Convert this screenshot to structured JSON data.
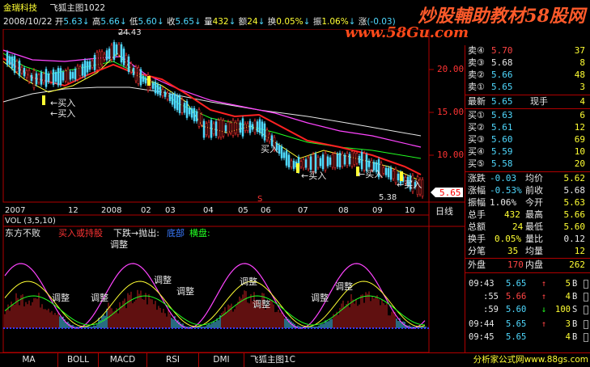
{
  "header": {
    "stock_name": "金瑞科技",
    "chart_name": "飞狐主图1022",
    "date": "2008/10/22",
    "open_label": "开",
    "open": "5.63",
    "high_label": "高",
    "high": "5.66",
    "low_label": "低",
    "low": "5.60",
    "close_label": "收",
    "close": "5.65",
    "volume_label": "量",
    "volume": "432",
    "amount_label": "额",
    "amount": "24",
    "turnover_label": "换",
    "turnover": "0.05%",
    "amplitude_label": "振",
    "amplitude": "1.06%",
    "change_label": "涨",
    "change": "(-0.03)",
    "arrow": "↓"
  },
  "watermark": {
    "line1": "炒股輔助教材58股网",
    "line2": "www.58Gu.com"
  },
  "main_chart": {
    "price_axis": [
      "20.00",
      "15.00",
      "10.00"
    ],
    "current_price_tag": "5.65",
    "peak_label": "24.43",
    "low_label": "5.38",
    "buy_labels": [
      "←买入",
      "←买入",
      "买入",
      "←买入",
      "←买入",
      "←买入"
    ],
    "marker_s": "S",
    "x_labels": [
      "2007",
      "12",
      "2008",
      "02",
      "03",
      "04",
      "05",
      "06",
      "07",
      "08",
      "09",
      "10"
    ],
    "period_label": "日线"
  },
  "volume_panel": {
    "label": "VOL (3,5,10)"
  },
  "indicator": {
    "name": "东方不败",
    "legend_buy_hold": "买入或持股",
    "legend_down_sell": "下跌→抛出:",
    "legend_bottom": "底部",
    "legend_flat": "横盘:",
    "adjust_label": "调整",
    "adjust_labels": [
      "调整",
      "调整",
      "调整",
      "调整",
      "调整",
      "调整",
      "调整",
      "调整",
      "调整"
    ]
  },
  "quote_panel": {
    "ask": [
      {
        "label": "卖④",
        "price": "5.70",
        "vol": "37"
      },
      {
        "label": "卖③",
        "price": "5.68",
        "vol": "8"
      },
      {
        "label": "卖②",
        "price": "5.66",
        "vol": "48"
      },
      {
        "label": "卖①",
        "price": "5.65",
        "vol": "3"
      }
    ],
    "latest_label": "最新",
    "latest": "5.65",
    "hand_label": "现手",
    "hand": "4",
    "bid": [
      {
        "label": "买①",
        "price": "5.63",
        "vol": "6"
      },
      {
        "label": "买②",
        "price": "5.61",
        "vol": "12"
      },
      {
        "label": "买③",
        "price": "5.60",
        "vol": "69"
      },
      {
        "label": "买④",
        "price": "5.59",
        "vol": "10"
      },
      {
        "label": "买⑤",
        "price": "5.58",
        "vol": "20"
      }
    ],
    "stats": [
      {
        "l1": "涨跌",
        "v1": "-0.03",
        "l2": "均价",
        "v2": "5.62"
      },
      {
        "l1": "涨幅",
        "v1": "-0.53%",
        "l2": "前收",
        "v2": "5.68"
      },
      {
        "l1": "振幅",
        "v1": "1.06%",
        "l2": "今开",
        "v2": "5.63"
      },
      {
        "l1": "总手",
        "v1": "432",
        "l2": "最高",
        "v2": "5.66"
      },
      {
        "l1": "总额",
        "v1": "24",
        "l2": "最低",
        "v2": "5.60"
      },
      {
        "l1": "换手",
        "v1": "0.05%",
        "l2": "量比",
        "v2": "0.12"
      },
      {
        "l1": "分笔",
        "v1": "35",
        "l2": "均量",
        "v2": "12"
      }
    ],
    "outer_label": "外盘",
    "outer": "170",
    "inner_label": "内盘",
    "inner": "262",
    "ticks": [
      {
        "time": "09:43",
        "price": "5.65",
        "arrow": "↑",
        "vol": "5",
        "side": "B"
      },
      {
        "time": ":55",
        "price": "5.66",
        "arrow": "↑",
        "vol": "4",
        "side": "B"
      },
      {
        "time": ":59",
        "price": "5.60",
        "arrow": "↓",
        "vol": "100",
        "side": "S"
      },
      {
        "time": "09:44",
        "price": "5.65",
        "arrow": "↑",
        "vol": "3",
        "side": "B"
      },
      {
        "time": "09:45",
        "price": "5.65",
        "arrow": "",
        "vol": "4",
        "side": "B"
      }
    ]
  },
  "bottom_tabs": [
    "MA",
    "BOLL",
    "MACD",
    "RSI",
    "DMI",
    "飞狐主图1C"
  ],
  "bottom_right_text": "分析家公式网www.88gs.com",
  "colors": {
    "up": "#ff3333",
    "down": "#4fd9ff",
    "frame": "#b00000",
    "ma_white": "#e8e8e8",
    "ma_yellow": "#ffff33",
    "ma_magenta": "#ff44ff",
    "ma_green": "#22ff22"
  }
}
